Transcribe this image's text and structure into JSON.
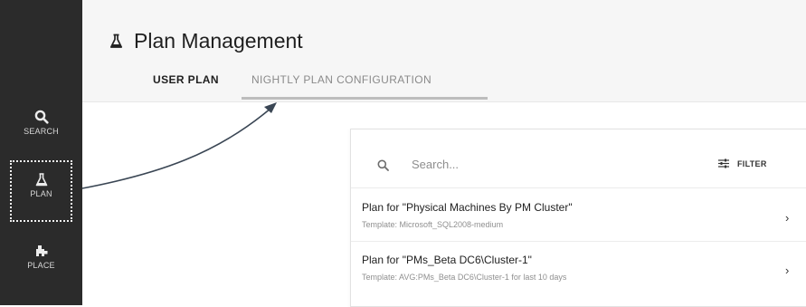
{
  "nav": {
    "items": [
      {
        "label": "SEARCH",
        "icon": "search-icon"
      },
      {
        "label": "PLAN",
        "icon": "flask-icon"
      },
      {
        "label": "PLACE",
        "icon": "place-icon"
      }
    ]
  },
  "header": {
    "title": "Plan Management",
    "icon": "flask-icon",
    "tabs": [
      {
        "label": "USER PLAN",
        "active": true
      },
      {
        "label": "NIGHTLY PLAN CONFIGURATION",
        "active": false
      }
    ]
  },
  "panel": {
    "search": {
      "placeholder": "Search..."
    },
    "filter_label": "FILTER",
    "plans": [
      {
        "name": "Plan for \"Physical Machines By PM Cluster\"",
        "template": "Template: Microsoft_SQL2008-medium"
      },
      {
        "name": "Plan for \"PMs_Beta DC6\\Cluster-1\"",
        "template": "Template: AVG:PMs_Beta DC6\\Cluster-1 for last 10 days"
      }
    ]
  },
  "colors": {
    "sidebar": "#2b2b2b",
    "header_bg": "#f6f6f6",
    "annotation_arrow": "#3a4654"
  }
}
